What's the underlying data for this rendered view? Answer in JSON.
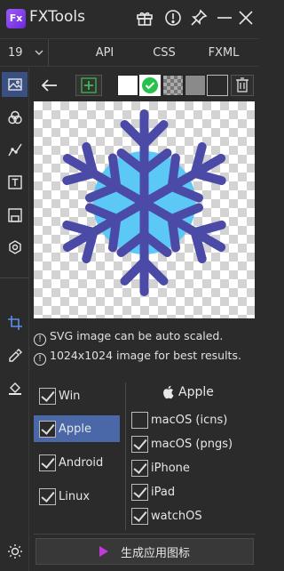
{
  "app": {
    "title": "FXTools",
    "logo_text": "Fx"
  },
  "tabs": {
    "version": "19",
    "items": [
      "API",
      "CSS",
      "FXML"
    ]
  },
  "info": {
    "line1": "SVG image can be auto scaled.",
    "line2": "1024x1024 image for best results."
  },
  "platforms": [
    {
      "label": "Win",
      "checked": true,
      "selected": false
    },
    {
      "label": "Apple",
      "checked": true,
      "selected": true
    },
    {
      "label": "Android",
      "checked": true,
      "selected": false
    },
    {
      "label": "Linux",
      "checked": true,
      "selected": false
    }
  ],
  "apple": {
    "heading": "Apple",
    "options": [
      {
        "label": "macOS (icns)",
        "checked": false
      },
      {
        "label": "macOS (pngs)",
        "checked": true
      },
      {
        "label": "iPhone",
        "checked": true
      },
      {
        "label": "iPad",
        "checked": true
      },
      {
        "label": "watchOS",
        "checked": true
      }
    ]
  },
  "generate_label": "生成应用图标",
  "colors": {
    "snowflake_arm": "#4b4aa6",
    "snowflake_core": "#5cc8f5",
    "accent": "#4a68a8",
    "logo": "#7c3aed",
    "play": "#c03ad9",
    "check_green": "#27c24c",
    "swatches": [
      "#ffffff",
      "#27c24c",
      "#888888",
      "#999999",
      "#2b2b2b"
    ]
  }
}
